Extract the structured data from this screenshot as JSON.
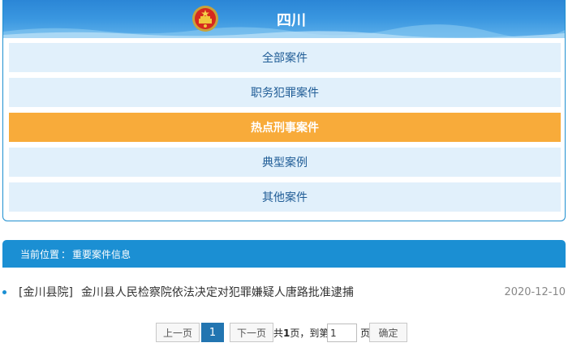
{
  "header": {
    "title": "四川",
    "emblem_icon": "national-emblem-icon",
    "colors": {
      "header_blue": "#2b86d6",
      "active_orange": "#f8ab3a",
      "item_bg": "#e1f0fb"
    }
  },
  "menu": {
    "items": [
      {
        "label": "全部案件",
        "active": false
      },
      {
        "label": "职务犯罪案件",
        "active": false
      },
      {
        "label": "热点刑事案件",
        "active": true
      },
      {
        "label": "典型案例",
        "active": false
      },
      {
        "label": "其他案件",
        "active": false
      }
    ]
  },
  "breadcrumb": {
    "prefix": "当前位置",
    "separator": "：",
    "current": "重要案件信息"
  },
  "list": {
    "items": [
      {
        "tag": "[金川县院]",
        "title": "金川县人民检察院依法决定对犯罪嫌疑人唐路批准逮捕",
        "date": "2020-12-10"
      }
    ]
  },
  "pagination": {
    "prev_label": "上一页",
    "current_page": "1",
    "next_label": "下一页",
    "total_prefix": "共",
    "total_pages": "1",
    "total_suffix": "页，到第",
    "goto_value": "1",
    "page_suffix": "页",
    "confirm_label": "确定"
  }
}
